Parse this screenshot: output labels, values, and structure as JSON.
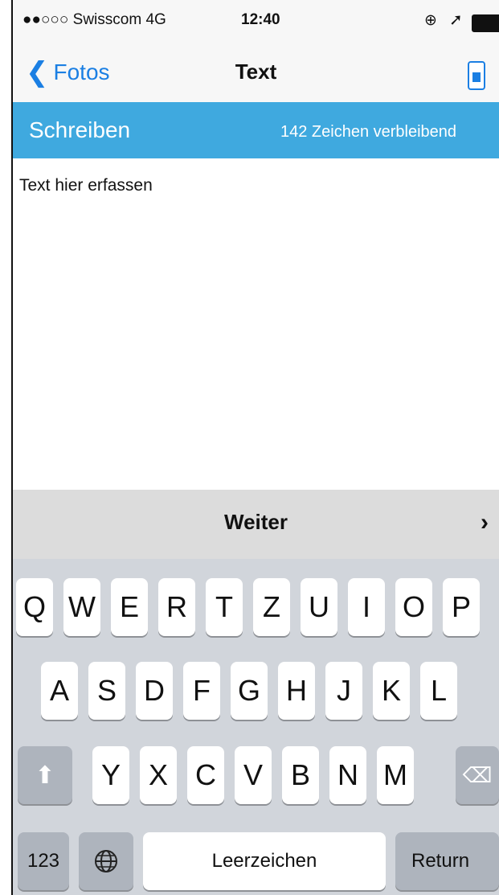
{
  "status_bar": {
    "carrier": "●●○○○ Swisscom  4G",
    "time": "12:40",
    "icons": [
      "lock-rotation-icon",
      "location-arrow-icon",
      "battery-icon"
    ]
  },
  "nav": {
    "back_label": "Fotos",
    "title": "Text"
  },
  "header": {
    "title": "Schreiben",
    "remaining": "142 Zeichen verbleibend"
  },
  "editor": {
    "placeholder": "Text hier erfassen"
  },
  "toolbar": {
    "weiter_label": "Weiter",
    "next_symbol": "›"
  },
  "keyboard": {
    "row1": [
      "Q",
      "W",
      "E",
      "R",
      "T",
      "Z",
      "U",
      "I",
      "O",
      "P"
    ],
    "row2": [
      "A",
      "S",
      "D",
      "F",
      "G",
      "H",
      "J",
      "K",
      "L"
    ],
    "row3": [
      "Y",
      "X",
      "C",
      "V",
      "B",
      "N",
      "M"
    ],
    "numbers_label": "123",
    "space_label": "Leerzeichen",
    "return_label": "Return"
  },
  "colors": {
    "accent": "#1b7fe3",
    "header_blue": "#3fa9df",
    "keyboard_bg": "#d1d5db"
  }
}
